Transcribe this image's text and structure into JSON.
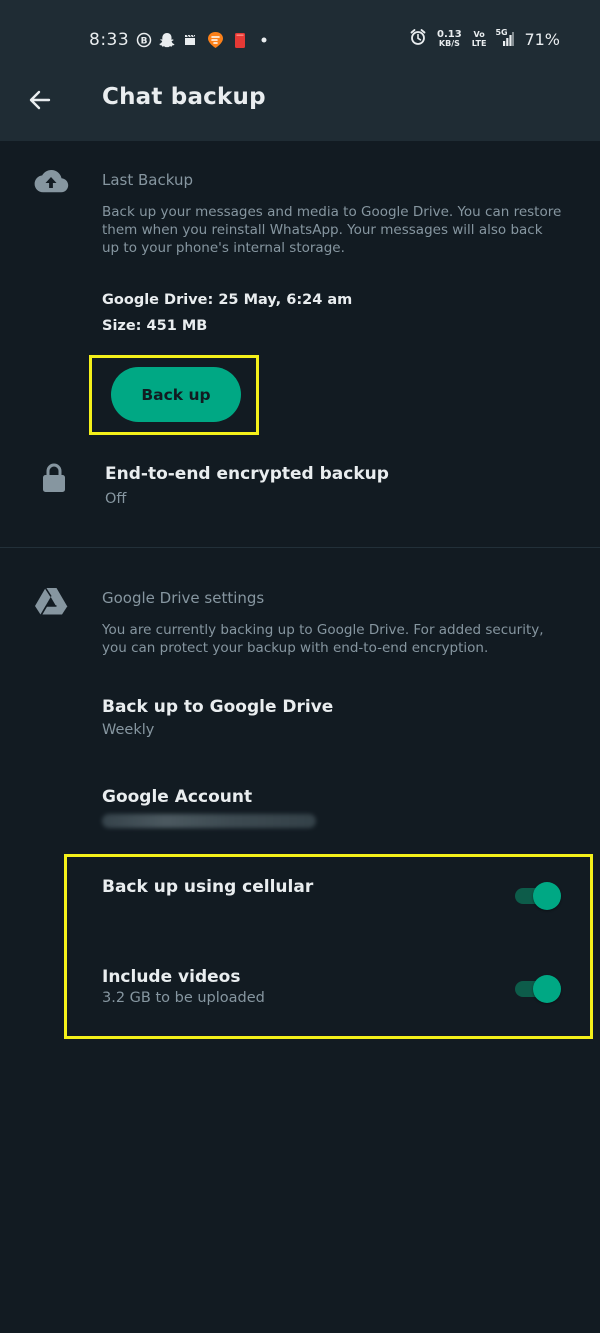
{
  "status_bar": {
    "time": "8:33",
    "net_speed_value": "0.13",
    "net_speed_unit": "KB/S",
    "volte_top": "Vo",
    "volte_bottom": "LTE",
    "signal_label": "5G",
    "battery": "71%"
  },
  "appbar": {
    "title": "Chat backup"
  },
  "last_backup": {
    "header": "Last Backup",
    "description": "Back up your messages and media to Google Drive. You can restore them when you reinstall WhatsApp. Your messages will also back up to your phone's internal storage.",
    "google_drive": "Google Drive: 25 May, 6:24 am",
    "size": "Size: 451 MB",
    "button_label": "Back up"
  },
  "e2e_backup": {
    "title": "End-to-end encrypted backup",
    "status": "Off"
  },
  "drive_settings": {
    "header": "Google Drive settings",
    "description": "You are currently backing up to Google Drive. For added security, you can protect your backup with end-to-end encryption.",
    "backup_to_drive_title": "Back up to Google Drive",
    "backup_to_drive_value": "Weekly",
    "account_title": "Google Account",
    "cellular_title": "Back up using cellular",
    "cellular_enabled": true,
    "videos_title": "Include videos",
    "videos_subtitle": "3.2 GB to be uploaded",
    "videos_enabled": true
  },
  "colors": {
    "background": "#121b22",
    "appbar": "#1f2c34",
    "accent": "#00a884",
    "highlight": "#f4f01a",
    "secondary_text": "#8696a0"
  }
}
